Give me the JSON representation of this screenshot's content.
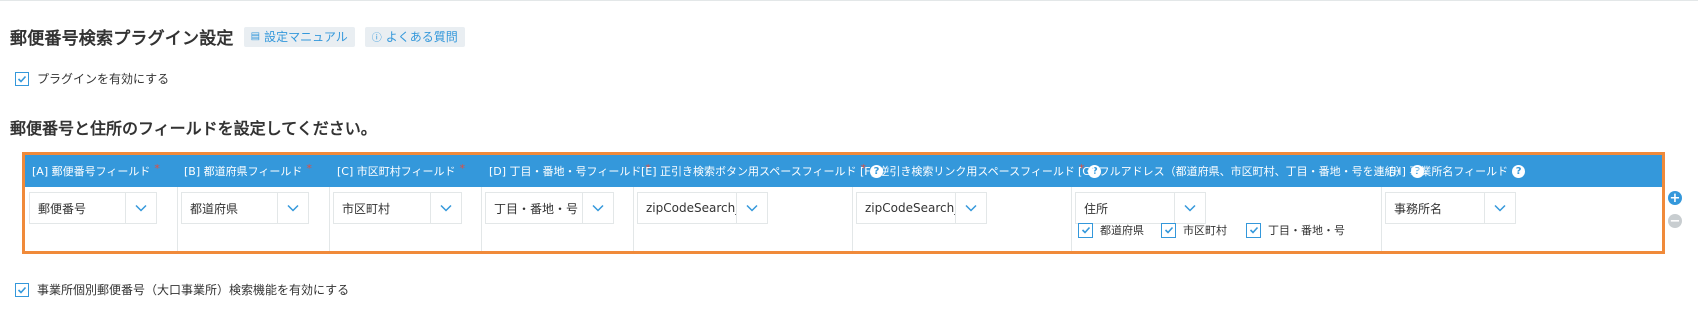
{
  "header": {
    "title": "郵便番号検索プラグイン設定",
    "manual_button": "設定マニュアル",
    "faq_button": "よくある質問"
  },
  "enable_plugin": {
    "label": "プラグインを有効にする",
    "checked": true
  },
  "section_title": "郵便番号と住所のフィールドを設定してください。",
  "columns": [
    {
      "label": "[A] 郵便番号フィールド",
      "required": "*",
      "value": "郵便番号"
    },
    {
      "label": "[B] 都道府県フィールド",
      "required": "*",
      "value": "都道府県"
    },
    {
      "label": "[C] 市区町村フィールド",
      "required": "*",
      "value": "市区町村"
    },
    {
      "label": "[D] 丁目・番地・号フィールド",
      "required": "*",
      "value": "丁目・番地・号"
    },
    {
      "label": "[E] 正引き検索ボタン用スペースフィールド",
      "required": "*",
      "help": "?",
      "value": "zipCodeSearch_ma"
    },
    {
      "label": "[F] 逆引き検索リンク用スペースフィールド",
      "required": "*",
      "help": "?",
      "value": "zipCodeSearch_ma"
    },
    {
      "label": "[G] フルアドレス（都道府県、市区町村、丁目・番地・号を連結）",
      "help": "?",
      "value": "住所",
      "options": [
        "都道府県",
        "市区町村",
        "丁目・番地・号"
      ]
    },
    {
      "label": "[H] 事業所名フィールド",
      "help": "?",
      "value": "事務所名"
    }
  ],
  "row_buttons": {
    "add": "+",
    "remove": "−"
  },
  "enable_office": {
    "label": "事業所個別郵便番号（大口事業所）検索機能を有効にする",
    "checked": true
  },
  "colors": {
    "accent": "#3498db",
    "highlight": "#f08a3a",
    "required": "#e74c3c"
  }
}
